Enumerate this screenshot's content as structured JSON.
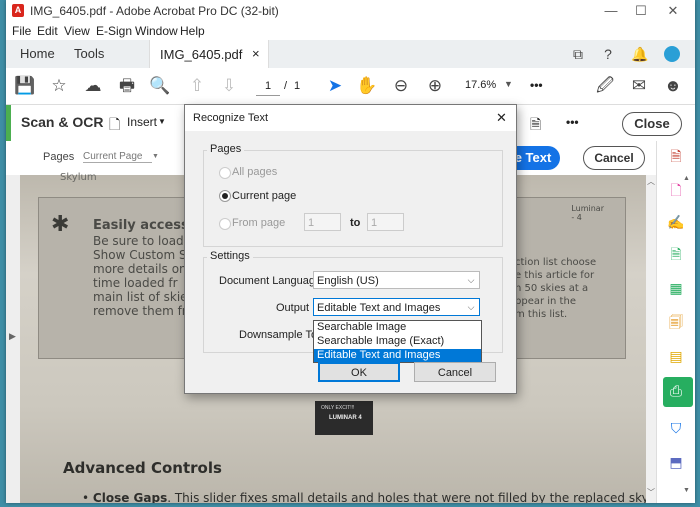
{
  "window": {
    "title": "IMG_6405.pdf - Adobe Acrobat Pro DC (32-bit)",
    "app_icon_letter": "A"
  },
  "menu": [
    "File",
    "Edit",
    "View",
    "E-Sign",
    "Window",
    "Help"
  ],
  "tabs": {
    "home": "Home",
    "tools": "Tools",
    "document": "IMG_6405.pdf",
    "close": "×"
  },
  "toolbar": {
    "page_current": "1",
    "page_sep": "/",
    "page_total": "1",
    "zoom": "17.6%",
    "more": "•••"
  },
  "scan_bar": {
    "title": "Scan & OCR",
    "insert": "Insert",
    "more": "•••",
    "close": "Close"
  },
  "pages_bar": {
    "label": "Pages",
    "page_select": "Current Page",
    "recognize_button": "e Text",
    "cancel": "Cancel"
  },
  "document": {
    "header_left": "Skylum",
    "header_right": "Luminar - 4",
    "box_title": "Easily access",
    "box_left_lines": [
      "Be sure to load",
      "Show Custom S",
      "more details on",
      "time loaded fr",
      "main list of skie",
      "remove them fro"
    ],
    "box_right_lines": [
      "ction list choose",
      "e this article for",
      "n 50 skies at a",
      "ppear in the",
      "m this list."
    ],
    "box_right_link": "this article",
    "image_labels": [
      "ONLY EXCIT!!!",
      "LUMINAR 4"
    ],
    "heading": "Advanced Controls",
    "bullet_bold": "Close Gaps",
    "bullet_text": ". This slider fixes small details and holes that were not filled by the replaced sky initially."
  },
  "dialog": {
    "title": "Recognize Text",
    "close": "✕",
    "pages_group": "Pages",
    "all_pages": "All pages",
    "current_page": "Current page",
    "from_page": "From page",
    "from_value": "1",
    "to_label": "to",
    "to_value": "1",
    "settings_group": "Settings",
    "doc_language_label": "Document Language",
    "doc_language_value": "English (US)",
    "output_label": "Output",
    "output_value": "Editable Text and Images",
    "downsample_label": "Downsample To",
    "output_options": [
      "Searchable Image",
      "Searchable Image (Exact)",
      "Editable Text and Images"
    ],
    "selected_option": "Editable Text and Images",
    "ok": "OK",
    "cancel": "Cancel"
  },
  "colors": {
    "accent_blue": "#1473e6",
    "scan_green": "#4caf50",
    "dd_highlight": "#0078d7"
  }
}
